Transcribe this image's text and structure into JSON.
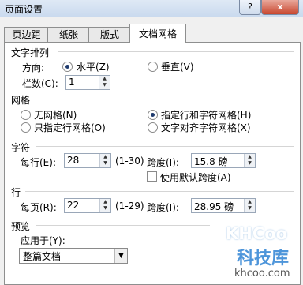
{
  "window": {
    "title": "页面设置",
    "help_glyph": "?",
    "close_glyph": "x"
  },
  "tabs": [
    "页边距",
    "纸张",
    "版式",
    "文档网格"
  ],
  "text_direction": {
    "heading": "文字排列",
    "direction_label": "方向:",
    "options": [
      "水平(Z)",
      "垂直(V)"
    ],
    "selected": "水平(Z)",
    "columns_label": "栏数(C):",
    "columns_value": "1"
  },
  "grid": {
    "heading": "网格",
    "options": [
      "无网格(N)",
      "指定行和字符网格(H)",
      "只指定行网格(O)",
      "文字对齐字符网格(X)"
    ],
    "selected": "指定行和字符网格(H)"
  },
  "chars": {
    "heading": "字符",
    "per_line_label": "每行(E):",
    "per_line_value": "28",
    "range": "(1-30)",
    "pitch_label": "跨度(I):",
    "pitch_value": "15.8 磅",
    "default_pitch_label": "使用默认跨度(A)",
    "default_pitch_checked": false
  },
  "lines": {
    "heading": "行",
    "per_page_label": "每页(R):",
    "per_page_value": "22",
    "range": "(1-29)",
    "pitch_label": "跨度(I):",
    "pitch_value": "28.95 磅"
  },
  "preview": {
    "heading": "预览",
    "apply_label": "应用于(Y):",
    "apply_value": "整篇文档"
  },
  "watermark": {
    "logo": "KHCoo",
    "text": "科技库",
    "url": "khcoo.com"
  }
}
